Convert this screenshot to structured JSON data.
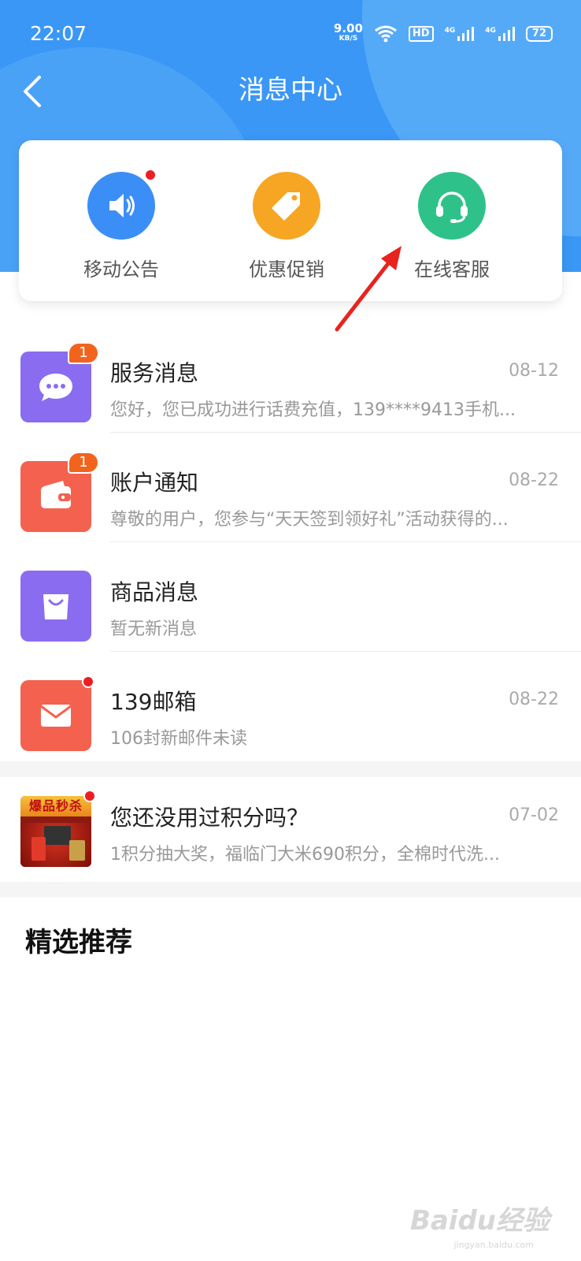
{
  "status_bar": {
    "time": "22:07",
    "net_speed_value": "9.00",
    "net_speed_unit": "KB/S",
    "hd_label": "HD",
    "signal1_label": "4G",
    "signal2_label": "4G",
    "battery": "72"
  },
  "header": {
    "title": "消息中心",
    "back_icon": "chevron-left-icon"
  },
  "quick_actions": [
    {
      "label": "移动公告",
      "icon": "speaker-icon",
      "color": "#3b8ef5",
      "has_dot": true
    },
    {
      "label": "优惠促销",
      "icon": "tag-icon",
      "color": "#f6a623",
      "has_dot": false
    },
    {
      "label": "在线客服",
      "icon": "headset-icon",
      "color": "#2ec28a",
      "has_dot": false
    }
  ],
  "messages": [
    {
      "title": "服务消息",
      "date": "08-12",
      "preview": "您好，您已成功进行话费充值，139****9413手机...",
      "icon": "chat-bubble-icon",
      "color": "#8a6cf0",
      "badge": "1"
    },
    {
      "title": "账户通知",
      "date": "08-22",
      "preview": "尊敬的用户，您参与“天天签到领好礼”活动获得的...",
      "icon": "wallet-icon",
      "color": "#f4624f",
      "badge": "1"
    },
    {
      "title": "商品消息",
      "date": "",
      "preview": "暂无新消息",
      "icon": "shopping-bag-icon",
      "color": "#8a6cf0",
      "badge": ""
    },
    {
      "title": "139邮箱",
      "date": "08-22",
      "preview": "106封新邮件未读",
      "icon": "mail-icon",
      "color": "#f4624f",
      "badge": "dot"
    }
  ],
  "promo": {
    "title": "您还没用过积分吗？",
    "date": "07-02",
    "preview": "1积分抽大奖，福临门大米690积分，全棉时代洗...",
    "thumb_tag": "爆品秒杀"
  },
  "recommend": {
    "title": "精选推荐"
  },
  "watermark": {
    "text": "Baidu经验",
    "sub": "jingyan.baidu.com"
  },
  "colors": {
    "header_blue": "#3a97f6",
    "arrow_red": "#e8231f"
  }
}
